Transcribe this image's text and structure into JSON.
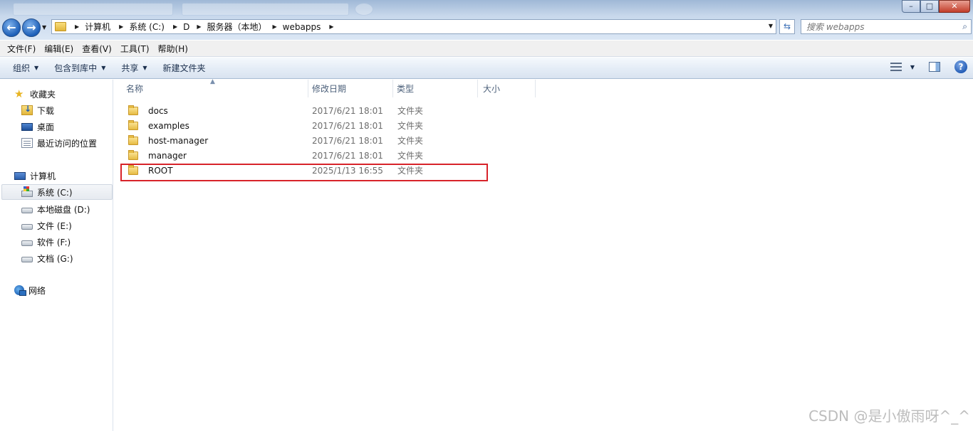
{
  "window": {
    "minimize_icon": "minimize-icon",
    "maximize_icon": "maximize-icon",
    "close_icon": "close-icon"
  },
  "address": {
    "crumbs": [
      "计算机",
      "系统 (C:)",
      "D",
      "服务器（本地）",
      "webapps"
    ]
  },
  "search": {
    "placeholder": "搜索 webapps"
  },
  "menu": [
    "文件(F)",
    "编辑(E)",
    "查看(V)",
    "工具(T)",
    "帮助(H)"
  ],
  "commands": {
    "organize": "组织",
    "include_library": "包含到库中",
    "share": "共享",
    "new_folder": "新建文件夹"
  },
  "nav": {
    "favorites": "收藏夹",
    "downloads": "下载",
    "desktop": "桌面",
    "recent": "最近访问的位置",
    "computer": "计算机",
    "drives": [
      "系统 (C:)",
      "本地磁盘 (D:)",
      "文件 (E:)",
      "软件 (F:)",
      "文档 (G:)"
    ],
    "network": "网络"
  },
  "columns": {
    "name": "名称",
    "date": "修改日期",
    "type": "类型",
    "size": "大小"
  },
  "files": [
    {
      "name": "docs",
      "date": "2017/6/21 18:01",
      "type": "文件夹"
    },
    {
      "name": "examples",
      "date": "2017/6/21 18:01",
      "type": "文件夹"
    },
    {
      "name": "host-manager",
      "date": "2017/6/21 18:01",
      "type": "文件夹"
    },
    {
      "name": "manager",
      "date": "2017/6/21 18:01",
      "type": "文件夹"
    },
    {
      "name": "ROOT",
      "date": "2025/1/13 16:55",
      "type": "文件夹"
    }
  ],
  "watermark": "CSDN @是小傲雨呀^_^",
  "colors": {
    "highlight": "#d8232a",
    "accent": "#1d5fb8"
  }
}
